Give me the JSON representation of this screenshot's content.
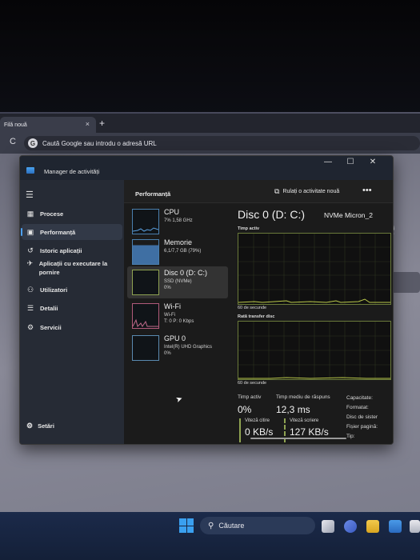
{
  "browser": {
    "tab_title": "Filă nouă",
    "tab_close": "×",
    "new_tab": "+",
    "reload": "C",
    "omnibox_placeholder": "Caută Google sau introdu o adresă URL",
    "google_letter": "G",
    "background_letter": "e"
  },
  "task_manager": {
    "title": "Manager de activități",
    "window_buttons": [
      "—",
      "☐",
      "✕"
    ],
    "sidebar": {
      "items": [
        {
          "label": "Procese"
        },
        {
          "label": "Performanță",
          "active": true
        },
        {
          "label": "Istoric aplicații"
        },
        {
          "label": "Aplicații cu executare la pornire"
        },
        {
          "label": "Utilizatori"
        },
        {
          "label": "Detalii"
        },
        {
          "label": "Servicii"
        }
      ],
      "settings_label": "Setări"
    },
    "header": {
      "title": "Performanță",
      "run_task_label": "Rulați o activitate nouă",
      "more_label": "•••"
    },
    "perf_list": [
      {
        "name": "CPU",
        "lines": [
          "7% 1,58 GHz"
        ]
      },
      {
        "name": "Memorie",
        "lines": [
          "6,1/7,7 GB (79%)"
        ]
      },
      {
        "name": "Disc 0 (D: C:)",
        "lines": [
          "SSD (NVMe)",
          "0%"
        ],
        "selected": true
      },
      {
        "name": "Wi-Fi",
        "lines": [
          "Wi-Fi",
          "T: 0 P: 0 Kbps"
        ]
      },
      {
        "name": "GPU 0",
        "lines": [
          "Intel(R) UHD Graphics",
          "0%"
        ]
      }
    ],
    "detail": {
      "title": "Disc 0 (D: C:)",
      "model": "NVMe Micron_2",
      "graph1_label": "Timp activ",
      "graph1_footer": "60 de secunde",
      "graph2_label": "Rată transfer disc",
      "graph2_footer": "60 de secunde",
      "active_time_label": "Timp activ",
      "active_time_value": "0%",
      "avg_response_label": "Timp mediu de răspuns",
      "avg_response_value": "12,3 ms",
      "read_speed_label": "Viteză citire",
      "read_speed_value": "0 KB/s",
      "write_speed_label": "Viteză scriere",
      "write_speed_value": "127 KB/s",
      "props": [
        "Capacitate:",
        "Formatat:",
        "Disc de sister",
        "Fișier pagină:",
        "Tip:"
      ]
    }
  },
  "taskbar": {
    "search_label": "Căutare"
  },
  "colors": {
    "accent": "#4ea1f2",
    "disk_green": "#8fa352",
    "sidebar_bg": "#262b35",
    "window_bg": "#1c1c1c"
  }
}
